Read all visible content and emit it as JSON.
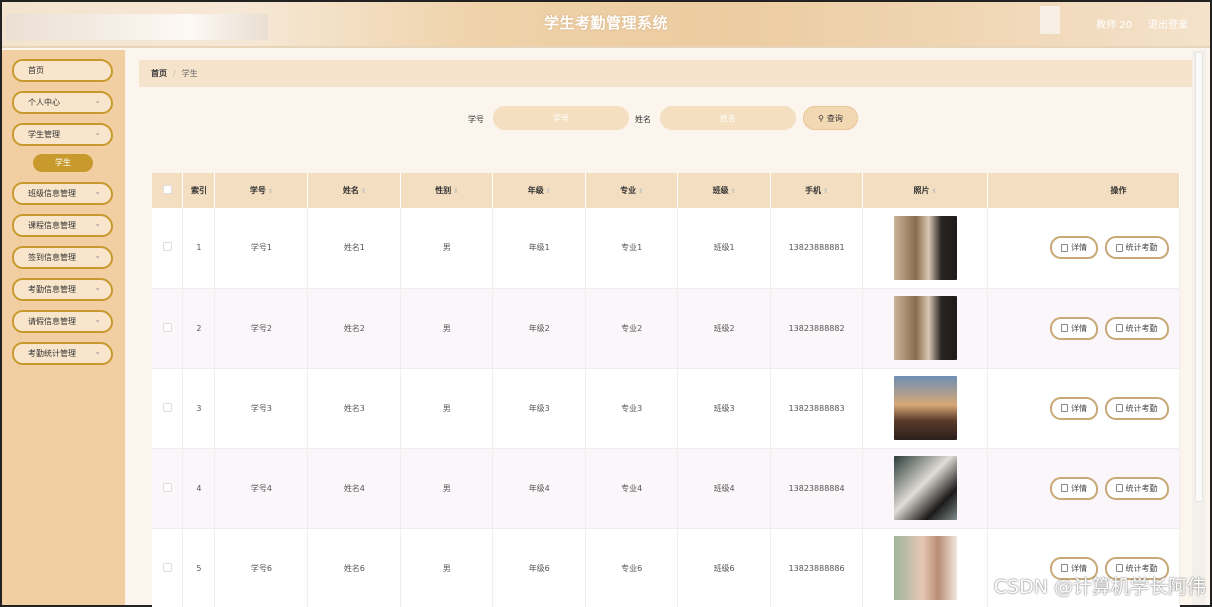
{
  "header": {
    "title": "学生考勤管理系统",
    "user": "教师 20",
    "logout": "退出登录"
  },
  "sidebar": {
    "items": [
      {
        "label": "首页"
      },
      {
        "label": "个人中心"
      },
      {
        "label": "学生管理"
      },
      {
        "label": "学生"
      },
      {
        "label": "班级信息管理"
      },
      {
        "label": "课程信息管理"
      },
      {
        "label": "签到信息管理"
      },
      {
        "label": "考勤信息管理"
      },
      {
        "label": "请假信息管理"
      },
      {
        "label": "考勤统计管理"
      }
    ]
  },
  "breadcrumb": {
    "home": "首页",
    "separator": "/",
    "current": "学生"
  },
  "search": {
    "student_no_label": "学号",
    "student_no_placeholder": "学号",
    "name_label": "姓名",
    "name_placeholder": "姓名",
    "button": "查询"
  },
  "table": {
    "headers": [
      "索引",
      "学号",
      "姓名",
      "性别",
      "年级",
      "专业",
      "班级",
      "手机",
      "照片",
      "操作"
    ],
    "rows": [
      {
        "index": "1",
        "no": "学号1",
        "name": "姓名1",
        "gender": "男",
        "grade": "年级1",
        "major": "专业1",
        "class": "班级1",
        "phone": "13823888881"
      },
      {
        "index": "2",
        "no": "学号2",
        "name": "姓名2",
        "gender": "男",
        "grade": "年级2",
        "major": "专业2",
        "class": "班级2",
        "phone": "13823888882"
      },
      {
        "index": "3",
        "no": "学号3",
        "name": "姓名3",
        "gender": "男",
        "grade": "年级3",
        "major": "专业3",
        "class": "班级3",
        "phone": "13823888883"
      },
      {
        "index": "4",
        "no": "学号4",
        "name": "姓名4",
        "gender": "男",
        "grade": "年级4",
        "major": "专业4",
        "class": "班级4",
        "phone": "13823888884"
      },
      {
        "index": "5",
        "no": "学号6",
        "name": "姓名6",
        "gender": "男",
        "grade": "年级6",
        "major": "专业6",
        "class": "班级6",
        "phone": "13823888886"
      }
    ],
    "actions": {
      "detail": "详情",
      "stats": "统计考勤"
    }
  },
  "watermark": "CSDN @计算机学长阿伟",
  "colors": {
    "accent": "#c89a2e",
    "sidebar_bg": "#f2cfa2",
    "header_th_bg": "#f3dec1"
  }
}
